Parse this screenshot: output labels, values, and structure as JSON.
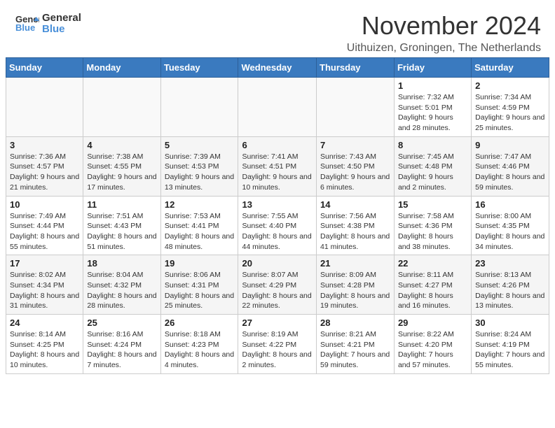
{
  "header": {
    "logo_text_general": "General",
    "logo_text_blue": "Blue",
    "month_title": "November 2024",
    "location": "Uithuizen, Groningen, The Netherlands"
  },
  "days_of_week": [
    "Sunday",
    "Monday",
    "Tuesday",
    "Wednesday",
    "Thursday",
    "Friday",
    "Saturday"
  ],
  "weeks": [
    [
      {
        "day": "",
        "info": ""
      },
      {
        "day": "",
        "info": ""
      },
      {
        "day": "",
        "info": ""
      },
      {
        "day": "",
        "info": ""
      },
      {
        "day": "",
        "info": ""
      },
      {
        "day": "1",
        "info": "Sunrise: 7:32 AM\nSunset: 5:01 PM\nDaylight: 9 hours and 28 minutes."
      },
      {
        "day": "2",
        "info": "Sunrise: 7:34 AM\nSunset: 4:59 PM\nDaylight: 9 hours and 25 minutes."
      }
    ],
    [
      {
        "day": "3",
        "info": "Sunrise: 7:36 AM\nSunset: 4:57 PM\nDaylight: 9 hours and 21 minutes."
      },
      {
        "day": "4",
        "info": "Sunrise: 7:38 AM\nSunset: 4:55 PM\nDaylight: 9 hours and 17 minutes."
      },
      {
        "day": "5",
        "info": "Sunrise: 7:39 AM\nSunset: 4:53 PM\nDaylight: 9 hours and 13 minutes."
      },
      {
        "day": "6",
        "info": "Sunrise: 7:41 AM\nSunset: 4:51 PM\nDaylight: 9 hours and 10 minutes."
      },
      {
        "day": "7",
        "info": "Sunrise: 7:43 AM\nSunset: 4:50 PM\nDaylight: 9 hours and 6 minutes."
      },
      {
        "day": "8",
        "info": "Sunrise: 7:45 AM\nSunset: 4:48 PM\nDaylight: 9 hours and 2 minutes."
      },
      {
        "day": "9",
        "info": "Sunrise: 7:47 AM\nSunset: 4:46 PM\nDaylight: 8 hours and 59 minutes."
      }
    ],
    [
      {
        "day": "10",
        "info": "Sunrise: 7:49 AM\nSunset: 4:44 PM\nDaylight: 8 hours and 55 minutes."
      },
      {
        "day": "11",
        "info": "Sunrise: 7:51 AM\nSunset: 4:43 PM\nDaylight: 8 hours and 51 minutes."
      },
      {
        "day": "12",
        "info": "Sunrise: 7:53 AM\nSunset: 4:41 PM\nDaylight: 8 hours and 48 minutes."
      },
      {
        "day": "13",
        "info": "Sunrise: 7:55 AM\nSunset: 4:40 PM\nDaylight: 8 hours and 44 minutes."
      },
      {
        "day": "14",
        "info": "Sunrise: 7:56 AM\nSunset: 4:38 PM\nDaylight: 8 hours and 41 minutes."
      },
      {
        "day": "15",
        "info": "Sunrise: 7:58 AM\nSunset: 4:36 PM\nDaylight: 8 hours and 38 minutes."
      },
      {
        "day": "16",
        "info": "Sunrise: 8:00 AM\nSunset: 4:35 PM\nDaylight: 8 hours and 34 minutes."
      }
    ],
    [
      {
        "day": "17",
        "info": "Sunrise: 8:02 AM\nSunset: 4:34 PM\nDaylight: 8 hours and 31 minutes."
      },
      {
        "day": "18",
        "info": "Sunrise: 8:04 AM\nSunset: 4:32 PM\nDaylight: 8 hours and 28 minutes."
      },
      {
        "day": "19",
        "info": "Sunrise: 8:06 AM\nSunset: 4:31 PM\nDaylight: 8 hours and 25 minutes."
      },
      {
        "day": "20",
        "info": "Sunrise: 8:07 AM\nSunset: 4:29 PM\nDaylight: 8 hours and 22 minutes."
      },
      {
        "day": "21",
        "info": "Sunrise: 8:09 AM\nSunset: 4:28 PM\nDaylight: 8 hours and 19 minutes."
      },
      {
        "day": "22",
        "info": "Sunrise: 8:11 AM\nSunset: 4:27 PM\nDaylight: 8 hours and 16 minutes."
      },
      {
        "day": "23",
        "info": "Sunrise: 8:13 AM\nSunset: 4:26 PM\nDaylight: 8 hours and 13 minutes."
      }
    ],
    [
      {
        "day": "24",
        "info": "Sunrise: 8:14 AM\nSunset: 4:25 PM\nDaylight: 8 hours and 10 minutes."
      },
      {
        "day": "25",
        "info": "Sunrise: 8:16 AM\nSunset: 4:24 PM\nDaylight: 8 hours and 7 minutes."
      },
      {
        "day": "26",
        "info": "Sunrise: 8:18 AM\nSunset: 4:23 PM\nDaylight: 8 hours and 4 minutes."
      },
      {
        "day": "27",
        "info": "Sunrise: 8:19 AM\nSunset: 4:22 PM\nDaylight: 8 hours and 2 minutes."
      },
      {
        "day": "28",
        "info": "Sunrise: 8:21 AM\nSunset: 4:21 PM\nDaylight: 7 hours and 59 minutes."
      },
      {
        "day": "29",
        "info": "Sunrise: 8:22 AM\nSunset: 4:20 PM\nDaylight: 7 hours and 57 minutes."
      },
      {
        "day": "30",
        "info": "Sunrise: 8:24 AM\nSunset: 4:19 PM\nDaylight: 7 hours and 55 minutes."
      }
    ]
  ]
}
